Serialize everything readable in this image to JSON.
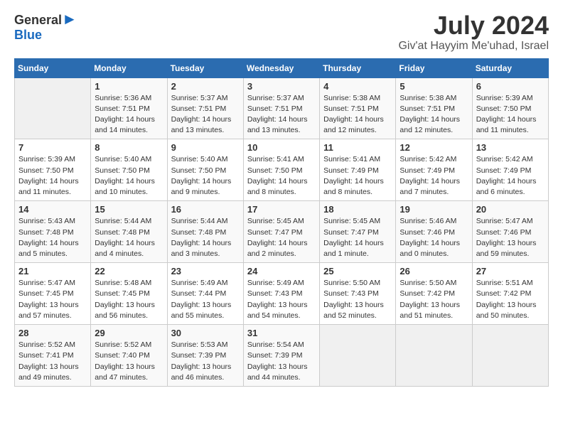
{
  "logo": {
    "text_general": "General",
    "text_blue": "Blue"
  },
  "header": {
    "month_year": "July 2024",
    "location": "Giv'at Hayyim Me'uhad, Israel"
  },
  "days_of_week": [
    "Sunday",
    "Monday",
    "Tuesday",
    "Wednesday",
    "Thursday",
    "Friday",
    "Saturday"
  ],
  "weeks": [
    [
      {
        "day": "",
        "info": ""
      },
      {
        "day": "1",
        "info": "Sunrise: 5:36 AM\nSunset: 7:51 PM\nDaylight: 14 hours\nand 14 minutes."
      },
      {
        "day": "2",
        "info": "Sunrise: 5:37 AM\nSunset: 7:51 PM\nDaylight: 14 hours\nand 13 minutes."
      },
      {
        "day": "3",
        "info": "Sunrise: 5:37 AM\nSunset: 7:51 PM\nDaylight: 14 hours\nand 13 minutes."
      },
      {
        "day": "4",
        "info": "Sunrise: 5:38 AM\nSunset: 7:51 PM\nDaylight: 14 hours\nand 12 minutes."
      },
      {
        "day": "5",
        "info": "Sunrise: 5:38 AM\nSunset: 7:51 PM\nDaylight: 14 hours\nand 12 minutes."
      },
      {
        "day": "6",
        "info": "Sunrise: 5:39 AM\nSunset: 7:50 PM\nDaylight: 14 hours\nand 11 minutes."
      }
    ],
    [
      {
        "day": "7",
        "info": "Sunrise: 5:39 AM\nSunset: 7:50 PM\nDaylight: 14 hours\nand 11 minutes."
      },
      {
        "day": "8",
        "info": "Sunrise: 5:40 AM\nSunset: 7:50 PM\nDaylight: 14 hours\nand 10 minutes."
      },
      {
        "day": "9",
        "info": "Sunrise: 5:40 AM\nSunset: 7:50 PM\nDaylight: 14 hours\nand 9 minutes."
      },
      {
        "day": "10",
        "info": "Sunrise: 5:41 AM\nSunset: 7:50 PM\nDaylight: 14 hours\nand 8 minutes."
      },
      {
        "day": "11",
        "info": "Sunrise: 5:41 AM\nSunset: 7:49 PM\nDaylight: 14 hours\nand 8 minutes."
      },
      {
        "day": "12",
        "info": "Sunrise: 5:42 AM\nSunset: 7:49 PM\nDaylight: 14 hours\nand 7 minutes."
      },
      {
        "day": "13",
        "info": "Sunrise: 5:42 AM\nSunset: 7:49 PM\nDaylight: 14 hours\nand 6 minutes."
      }
    ],
    [
      {
        "day": "14",
        "info": "Sunrise: 5:43 AM\nSunset: 7:48 PM\nDaylight: 14 hours\nand 5 minutes."
      },
      {
        "day": "15",
        "info": "Sunrise: 5:44 AM\nSunset: 7:48 PM\nDaylight: 14 hours\nand 4 minutes."
      },
      {
        "day": "16",
        "info": "Sunrise: 5:44 AM\nSunset: 7:48 PM\nDaylight: 14 hours\nand 3 minutes."
      },
      {
        "day": "17",
        "info": "Sunrise: 5:45 AM\nSunset: 7:47 PM\nDaylight: 14 hours\nand 2 minutes."
      },
      {
        "day": "18",
        "info": "Sunrise: 5:45 AM\nSunset: 7:47 PM\nDaylight: 14 hours\nand 1 minute."
      },
      {
        "day": "19",
        "info": "Sunrise: 5:46 AM\nSunset: 7:46 PM\nDaylight: 14 hours\nand 0 minutes."
      },
      {
        "day": "20",
        "info": "Sunrise: 5:47 AM\nSunset: 7:46 PM\nDaylight: 13 hours\nand 59 minutes."
      }
    ],
    [
      {
        "day": "21",
        "info": "Sunrise: 5:47 AM\nSunset: 7:45 PM\nDaylight: 13 hours\nand 57 minutes."
      },
      {
        "day": "22",
        "info": "Sunrise: 5:48 AM\nSunset: 7:45 PM\nDaylight: 13 hours\nand 56 minutes."
      },
      {
        "day": "23",
        "info": "Sunrise: 5:49 AM\nSunset: 7:44 PM\nDaylight: 13 hours\nand 55 minutes."
      },
      {
        "day": "24",
        "info": "Sunrise: 5:49 AM\nSunset: 7:43 PM\nDaylight: 13 hours\nand 54 minutes."
      },
      {
        "day": "25",
        "info": "Sunrise: 5:50 AM\nSunset: 7:43 PM\nDaylight: 13 hours\nand 52 minutes."
      },
      {
        "day": "26",
        "info": "Sunrise: 5:50 AM\nSunset: 7:42 PM\nDaylight: 13 hours\nand 51 minutes."
      },
      {
        "day": "27",
        "info": "Sunrise: 5:51 AM\nSunset: 7:42 PM\nDaylight: 13 hours\nand 50 minutes."
      }
    ],
    [
      {
        "day": "28",
        "info": "Sunrise: 5:52 AM\nSunset: 7:41 PM\nDaylight: 13 hours\nand 49 minutes."
      },
      {
        "day": "29",
        "info": "Sunrise: 5:52 AM\nSunset: 7:40 PM\nDaylight: 13 hours\nand 47 minutes."
      },
      {
        "day": "30",
        "info": "Sunrise: 5:53 AM\nSunset: 7:39 PM\nDaylight: 13 hours\nand 46 minutes."
      },
      {
        "day": "31",
        "info": "Sunrise: 5:54 AM\nSunset: 7:39 PM\nDaylight: 13 hours\nand 44 minutes."
      },
      {
        "day": "",
        "info": ""
      },
      {
        "day": "",
        "info": ""
      },
      {
        "day": "",
        "info": ""
      }
    ]
  ]
}
